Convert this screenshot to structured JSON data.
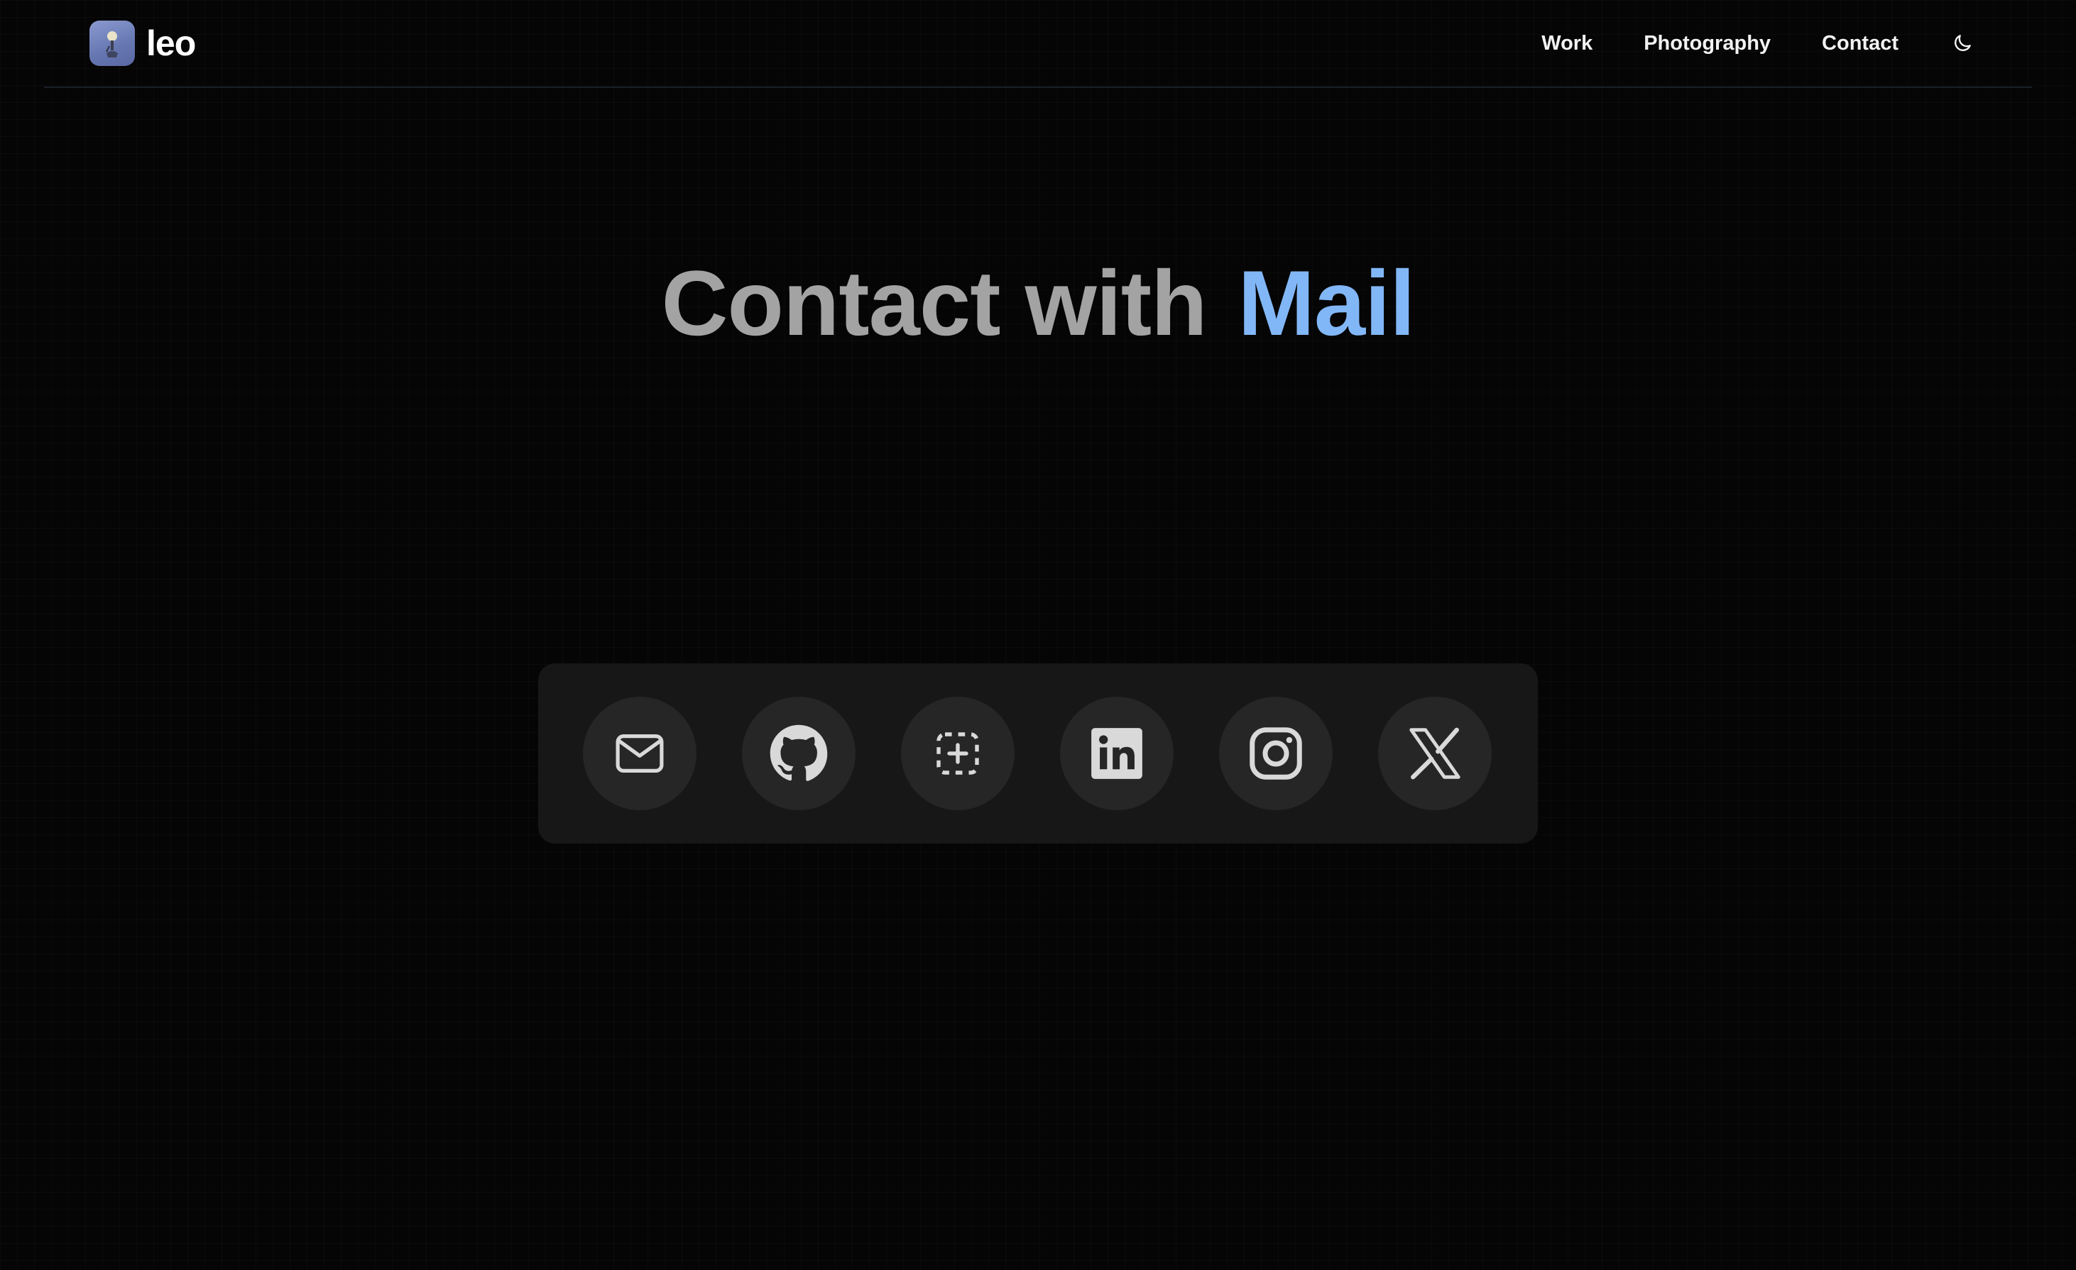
{
  "brand": {
    "name": "leo",
    "avatar_icon": "avatar-image-icon"
  },
  "nav": {
    "items": [
      {
        "label": "Work"
      },
      {
        "label": "Photography"
      },
      {
        "label": "Contact"
      }
    ],
    "theme_toggle_icon": "moon-icon"
  },
  "hero": {
    "prefix": "Contact with",
    "accent": "Mail",
    "accent_color": "#82b7f7",
    "prefix_color": "#a3a3a3"
  },
  "contact_links": [
    {
      "icon": "mail-icon"
    },
    {
      "icon": "github-icon"
    },
    {
      "icon": "dashed-plus-icon"
    },
    {
      "icon": "linkedin-icon"
    },
    {
      "icon": "instagram-icon"
    },
    {
      "icon": "x-icon"
    }
  ],
  "colors": {
    "background": "#050505",
    "dock_background": "#171717",
    "button_background": "#262626",
    "icon_color": "#d9d9d9"
  }
}
